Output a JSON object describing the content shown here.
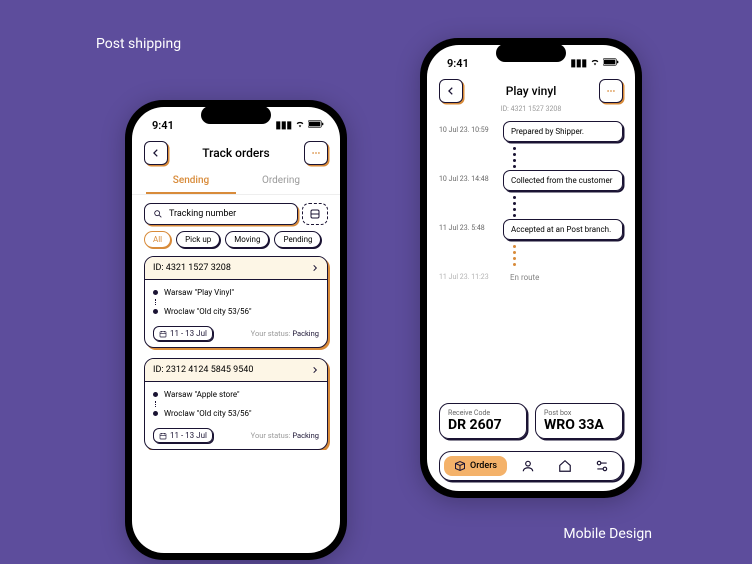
{
  "page": {
    "top_label": "Post shipping",
    "bottom_label": "Mobile Design"
  },
  "left": {
    "time": "9:41",
    "title": "Track orders",
    "tabs": {
      "sending": "Sending",
      "ordering": "Ordering"
    },
    "search_placeholder": "Tracking number",
    "chips": [
      "All",
      "Pick up",
      "Moving",
      "Pending"
    ],
    "cards": [
      {
        "id": "ID: 4321 1527 3208",
        "from": "Warsaw \"Play Vinyl\"",
        "to": "Wroclaw \"Old city 53/56\"",
        "date": "11 - 13 Jul",
        "status_label": "Your status:",
        "status_value": "Packing"
      },
      {
        "id": "ID: 2312 4124 5845 9540",
        "from": "Warsaw \"Apple store\"",
        "to": "Wroclaw \"Old city 53/56\"",
        "date": "11 - 13 Jul",
        "status_label": "Your status:",
        "status_value": "Packing"
      }
    ]
  },
  "right": {
    "time": "9:41",
    "title": "Play vinyl",
    "subtitle": "ID: 4321 1527 3208",
    "timeline": [
      {
        "time": "10 Jul 23. 10:59",
        "text": "Prepared by Shipper."
      },
      {
        "time": "10 Jul 23. 14:48",
        "text": "Collected from the customer"
      },
      {
        "time": "11 Jul 23. 5:48",
        "text": "Accepted at an Post branch."
      },
      {
        "time": "11 Jul 23. 11:23",
        "text": "En route"
      }
    ],
    "receive": {
      "label": "Receive Code",
      "value": "DR 2607"
    },
    "postbox": {
      "label": "Post box",
      "value": "WRO 33A"
    },
    "nav_active": "Orders"
  }
}
